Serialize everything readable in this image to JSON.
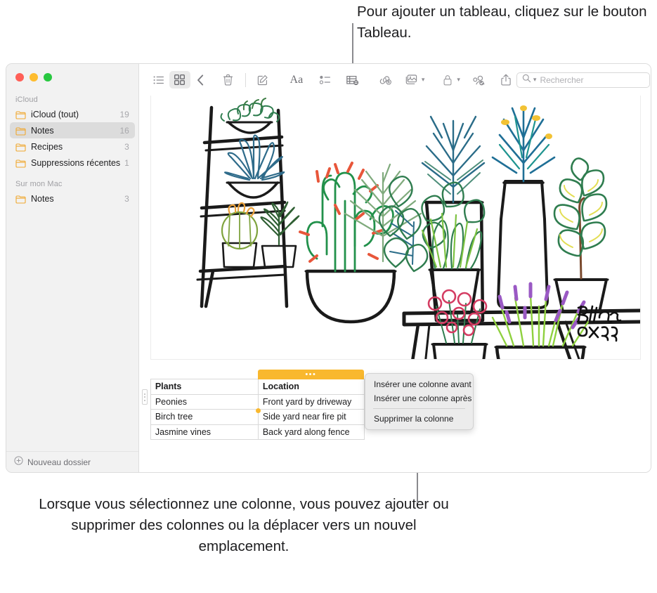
{
  "callouts": {
    "top": "Pour ajouter un tableau, cliquez sur le bouton Tableau.",
    "bottom": "Lorsque vous sélectionnez une colonne, vous pouvez ajouter ou supprimer des colonnes ou la déplacer vers un nouvel emplacement."
  },
  "sidebar": {
    "sections": [
      {
        "header": "iCloud",
        "items": [
          {
            "label": "iCloud (tout)",
            "count": "19",
            "selected": false
          },
          {
            "label": "Notes",
            "count": "16",
            "selected": true
          },
          {
            "label": "Recipes",
            "count": "3",
            "selected": false
          },
          {
            "label": "Suppressions récentes",
            "count": "1",
            "selected": false
          }
        ]
      },
      {
        "header": "Sur mon Mac",
        "items": [
          {
            "label": "Notes",
            "count": "3",
            "selected": false
          }
        ]
      }
    ],
    "new_folder_label": "Nouveau dossier",
    "new_folder_icon": "plus-circle-icon"
  },
  "toolbar": {
    "buttons": [
      {
        "name": "list-view-icon",
        "label": "Présentation par liste"
      },
      {
        "name": "grid-view-icon",
        "label": "Présentation par galerie"
      },
      {
        "name": "back-chevron-icon",
        "label": "Retour"
      },
      {
        "name": "trash-icon",
        "label": "Supprimer"
      },
      {
        "name": "compose-icon",
        "label": "Nouvelle note"
      },
      {
        "name": "format-aa-icon",
        "label": "Aa"
      },
      {
        "name": "checklist-icon",
        "label": "Liste de contrôle"
      },
      {
        "name": "table-icon",
        "label": "Tableau"
      },
      {
        "name": "link-icon",
        "label": "Lien"
      },
      {
        "name": "media-icon",
        "label": "Média"
      },
      {
        "name": "lock-icon",
        "label": "Verrouiller"
      },
      {
        "name": "add-people-icon",
        "label": "Ajouter des personnes"
      },
      {
        "name": "share-icon",
        "label": "Partager"
      }
    ],
    "aa_label": "Aa"
  },
  "search": {
    "placeholder": "Rechercher",
    "icon": "search-magnifier-icon"
  },
  "note": {
    "illustration_signature": "Bella",
    "illustration_signature_year": "2019",
    "table": {
      "selected_column_index": 1,
      "rows": [
        [
          "Plants",
          "Location"
        ],
        [
          "Peonies",
          "Front yard by driveway"
        ],
        [
          "Birch tree",
          "Side yard near fire pit"
        ],
        [
          "Jasmine vines",
          "Back yard along fence"
        ]
      ]
    }
  },
  "context_menu": {
    "items": [
      {
        "label": "Insérer une colonne avant",
        "separator_after": false
      },
      {
        "label": "Insérer une colonne après",
        "separator_after": true
      },
      {
        "label": "Supprimer la colonne",
        "separator_after": false
      }
    ]
  },
  "colors": {
    "selection_orange": "#f9b82e",
    "sidebar_bg": "#f2f2f2",
    "selected_row_bg": "#dcdcdc"
  }
}
